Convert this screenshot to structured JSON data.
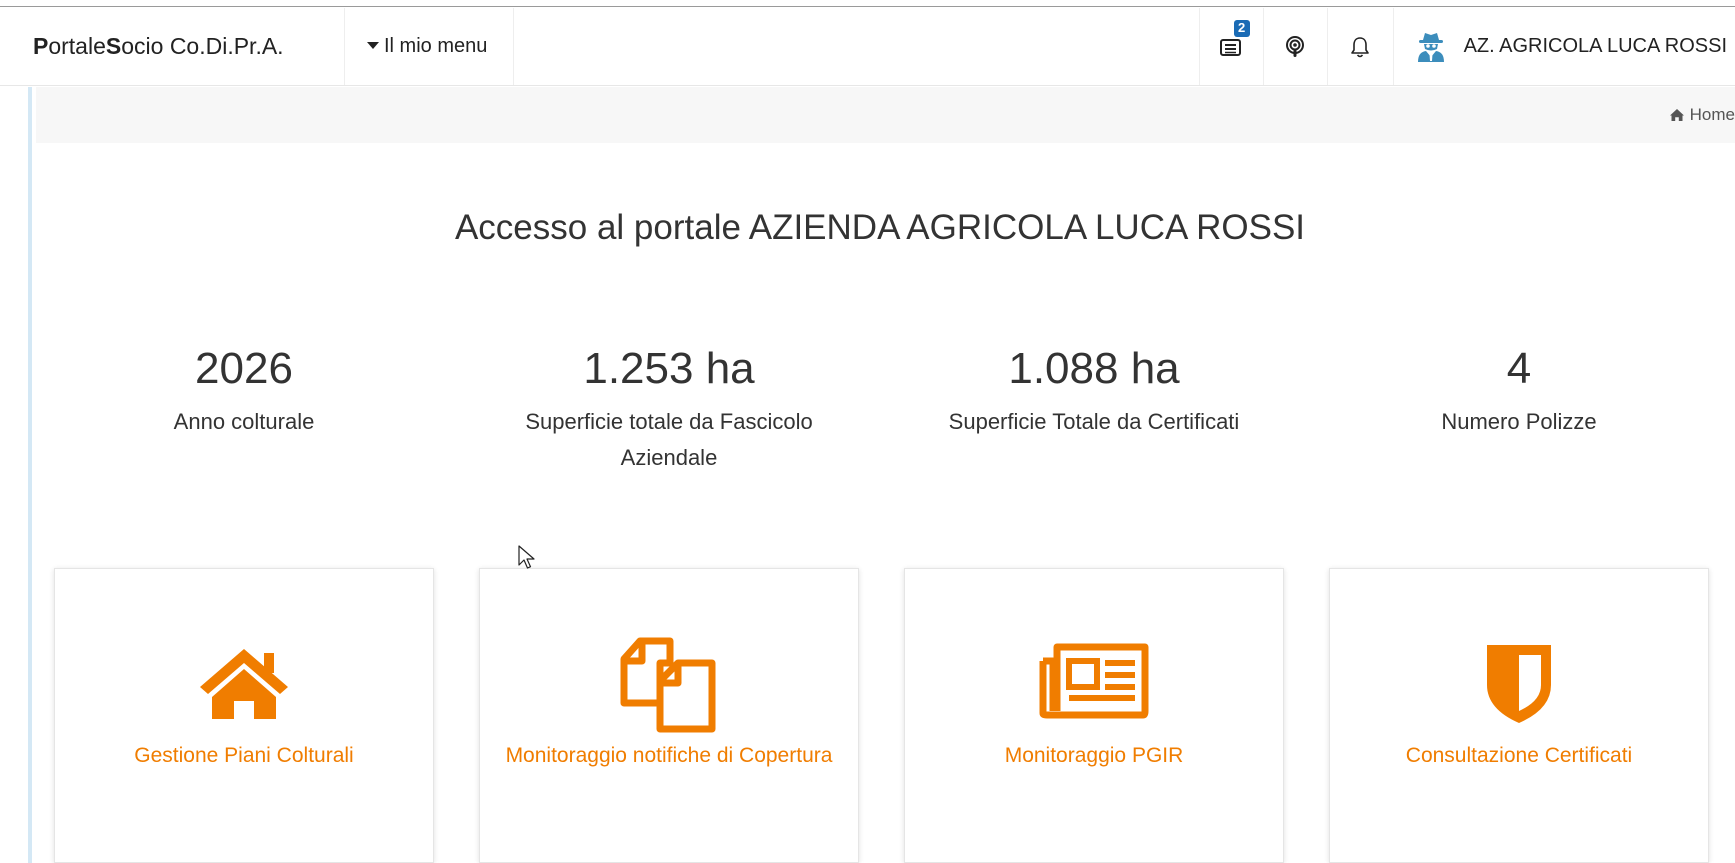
{
  "header": {
    "brand_p": "P",
    "brand_rest1": "ortale ",
    "brand_s": "S",
    "brand_rest2": "ocio Co.Di.Pr.A.",
    "menu_label": "Il mio menu",
    "messages_badge": "2",
    "user_name": "AZ. AGRICOLA LUCA ROSSI",
    "icons": [
      "messages-icon",
      "podcast-icon",
      "bell-icon",
      "user-secret-icon"
    ]
  },
  "breadcrumb": {
    "home_label": "Home"
  },
  "main": {
    "title": "Accesso al portale AZIENDA AGRICOLA LUCA ROSSI",
    "stats": [
      {
        "value": "2026",
        "label": "Anno colturale"
      },
      {
        "value": "1.253 ha",
        "label": "Superficie totale da Fascicolo Aziendale"
      },
      {
        "value": "1.088 ha",
        "label": "Superficie Totale da Certificati"
      },
      {
        "value": "4",
        "label": "Numero Polizze"
      }
    ],
    "tiles": [
      {
        "label": "Gestione Piani Colturali",
        "icon": "home-icon"
      },
      {
        "label": "Monitoraggio notifiche di Copertura",
        "icon": "copy-icon"
      },
      {
        "label": "Monitoraggio PGIR",
        "icon": "newspaper-icon"
      },
      {
        "label": "Consultazione Certificati",
        "icon": "shield-icon"
      }
    ]
  },
  "colors": {
    "accent": "#f07d00",
    "badge": "#1a6bb5",
    "user_icon": "#3c8dbc"
  }
}
